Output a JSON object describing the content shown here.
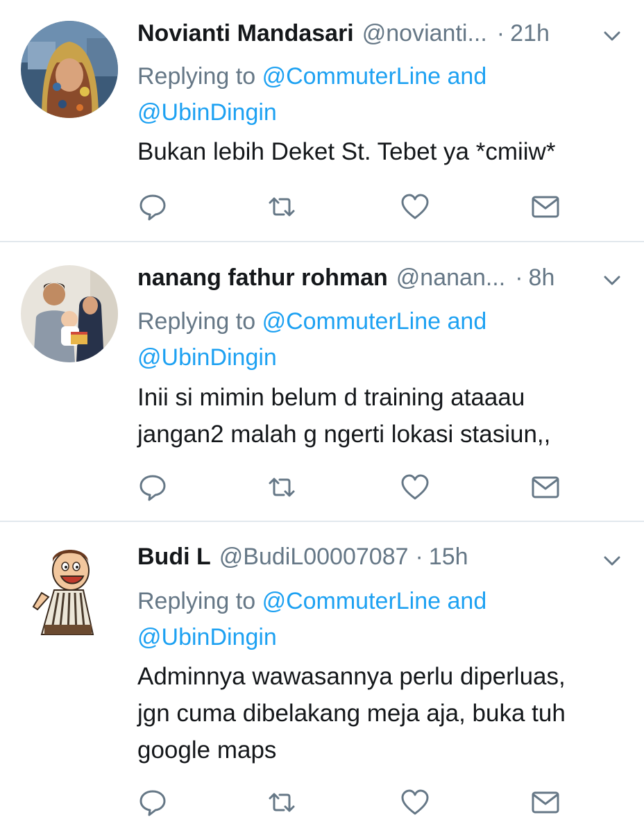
{
  "tweets": [
    {
      "name": "Novianti Mandasari",
      "handle": "@novianti...",
      "time": "21h",
      "reply_prefix": "Replying to",
      "reply_mention_1": "@CommuterLine",
      "reply_and": "and",
      "reply_mention_2": "@UbinDingin",
      "text": "Bukan lebih Deket St. Tebet ya *cmiiw*"
    },
    {
      "name": "nanang fathur rohman",
      "handle": "@nanan...",
      "time": "8h",
      "reply_prefix": "Replying to",
      "reply_mention_1": "@CommuterLine",
      "reply_and": "and",
      "reply_mention_2": "@UbinDingin",
      "text_line_1": "Inii si mimin belum d training ataaau",
      "text_line_2": "jangan2 malah g ngerti lokasi stasiun,,"
    },
    {
      "name": "Budi L",
      "handle": "@BudiL00007087",
      "time": "15h",
      "reply_prefix": "Replying to",
      "reply_mention_1": "@CommuterLine",
      "reply_and": "and",
      "reply_mention_2": "@UbinDingin",
      "text_line_1": "Adminnya wawasannya perlu diperluas,",
      "text_line_2": "jgn cuma dibelakang meja aja, buka tuh",
      "text_line_3": "google maps"
    }
  ],
  "separator": "·",
  "icons": {
    "reply": "reply-icon",
    "retweet": "retweet-icon",
    "like": "heart-icon",
    "dm": "envelope-icon",
    "menu": "chevron-down-icon"
  },
  "colors": {
    "link": "#1da1f2",
    "secondary": "#657786",
    "primary_text": "#14171a",
    "divider": "#e1e8ed"
  }
}
